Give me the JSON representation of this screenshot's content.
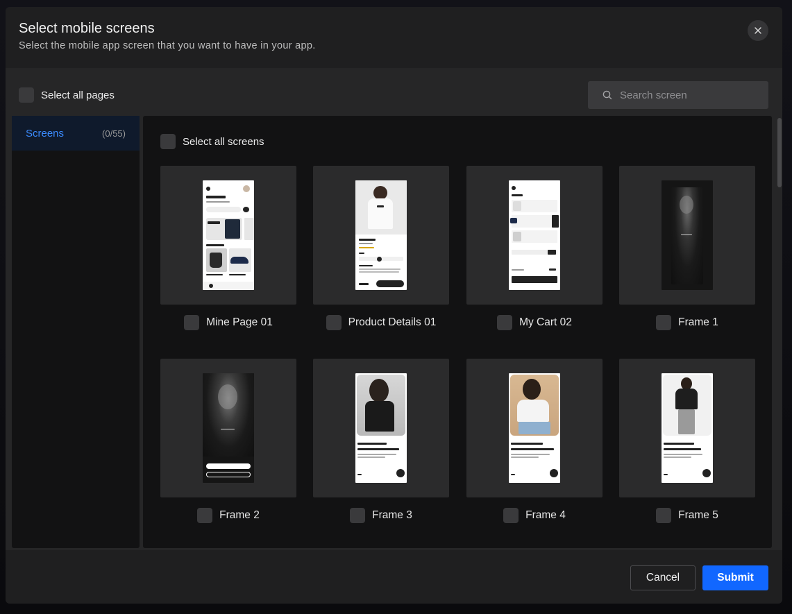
{
  "dialog": {
    "title": "Select mobile screens",
    "subtitle": "Select the mobile app screen that you want to have in your app."
  },
  "toolbar": {
    "select_all_pages_label": "Select all pages",
    "search_placeholder": "Search screen"
  },
  "sidebar": {
    "items": [
      {
        "label": "Screens",
        "count": "(0/55)"
      }
    ]
  },
  "content": {
    "select_all_screens_label": "Select all screens",
    "screens": [
      {
        "label": "Mine Page 01"
      },
      {
        "label": "Product Details 01"
      },
      {
        "label": "My Cart 02"
      },
      {
        "label": "Frame 1"
      },
      {
        "label": "Frame 2"
      },
      {
        "label": "Frame 3"
      },
      {
        "label": "Frame 4"
      },
      {
        "label": "Frame 5"
      }
    ]
  },
  "footer": {
    "cancel_label": "Cancel",
    "submit_label": "Submit"
  },
  "colors": {
    "accent": "#1167ff",
    "active_text": "#3b8bff",
    "panel": "#121213",
    "modal": "#1f1f20"
  },
  "icons": {
    "close": "close-icon",
    "search": "search-icon"
  }
}
